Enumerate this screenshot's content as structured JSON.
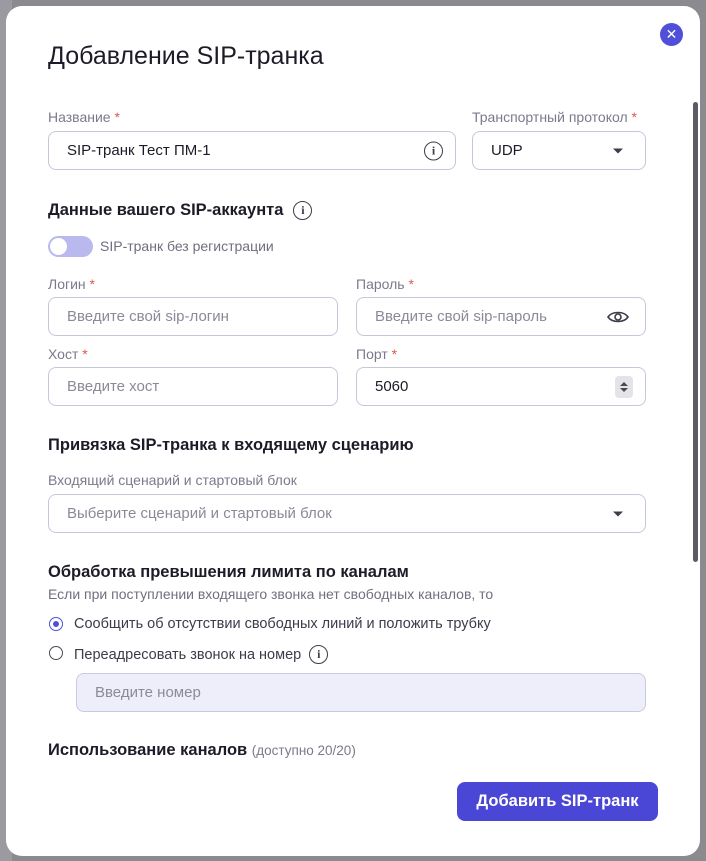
{
  "dialog": {
    "title": "Добавление SIP-транка",
    "close_icon": "close-icon"
  },
  "name_field": {
    "label": "Название",
    "required_mark": "*",
    "value": "SIP-транк Тест ПМ-1"
  },
  "transport": {
    "label": "Транспортный протокол",
    "required_mark": "*",
    "value": "UDP"
  },
  "account_section": {
    "title": "Данные вашего SIP-аккаунта",
    "toggle_label": "SIP-транк без регистрации",
    "toggle_on": false
  },
  "login": {
    "label": "Логин",
    "required_mark": "*",
    "placeholder": "Введите свой sip-логин"
  },
  "password": {
    "label": "Пароль",
    "required_mark": "*",
    "placeholder": "Введите свой sip-пароль"
  },
  "host": {
    "label": "Хост",
    "required_mark": "*",
    "placeholder": "Введите хост"
  },
  "port": {
    "label": "Порт",
    "required_mark": "*",
    "value": "5060"
  },
  "binding_section": {
    "title": "Привязка SIP-транка к входящему сценарию",
    "select_label": "Входящий сценарий и стартовый блок",
    "select_placeholder": "Выберите сценарий и стартовый блок"
  },
  "overflow_section": {
    "title": "Обработка превышения лимита по каналам",
    "description": "Если при поступлении входящего звонка нет свободных каналов, то",
    "option_hangup": "Сообщить об отсутствии свободных линий и положить трубку",
    "option_redirect": "Переадресовать звонок на номер",
    "selected": "hangup",
    "number_placeholder": "Введите номер"
  },
  "channels_section": {
    "title": "Использование каналов",
    "availability": "(доступно 20/20)"
  },
  "footer": {
    "submit_label": "Добавить SIP-транк"
  },
  "colors": {
    "accent": "#4f4fd9",
    "required": "#e0574f"
  }
}
